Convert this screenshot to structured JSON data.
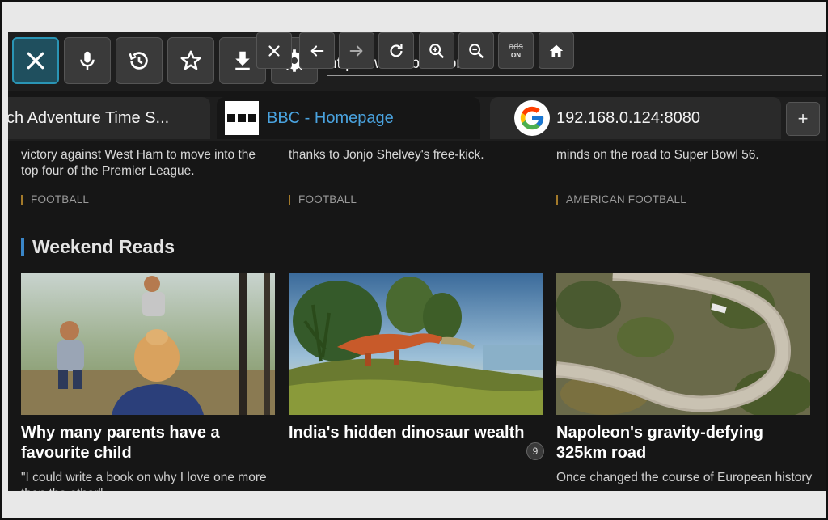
{
  "toolbar": {
    "url": "https://www.bbc.com/",
    "buttons": [
      "close-icon",
      "microphone-icon",
      "history-icon",
      "star-icon",
      "download-icon",
      "gear-icon"
    ]
  },
  "tabs": [
    {
      "label": "ch Adventure Time S..."
    },
    {
      "label": "BBC - Homepage",
      "active": true
    },
    {
      "label": "192.168.0.124:8080"
    }
  ],
  "newtab_label": "+",
  "top_articles": [
    {
      "snippet": "victory against West Ham to move into the top four of the Premier League.",
      "tag": "FOOTBALL"
    },
    {
      "snippet": "thanks to Jonjo Shelvey's free-kick.",
      "tag": "FOOTBALL"
    },
    {
      "snippet": "minds on the road to Super Bowl 56.",
      "tag": "AMERICAN FOOTBALL"
    }
  ],
  "section_title": "Weekend Reads",
  "cards": [
    {
      "title": "Why many parents have a favourite child",
      "desc": "\"I could write a book on why I love one more than the other\""
    },
    {
      "title": "India's hidden dinosaur wealth",
      "desc": ""
    },
    {
      "title": "Napoleon's gravity-defying 325km road",
      "desc": "Once changed the course of European history"
    }
  ],
  "bottom_bar": {
    "buttons": [
      "close-icon",
      "back-arrow-icon",
      "forward-arrow-icon",
      "reload-icon",
      "zoom-in-icon",
      "zoom-out-icon",
      "ads-toggle",
      "home-icon"
    ],
    "ads_label": "ads",
    "ads_state": "ON",
    "ads_count": "9"
  },
  "colors": {
    "accent": "#2a95b5",
    "link": "#4aa3df",
    "section_bar": "#3a86c8"
  }
}
